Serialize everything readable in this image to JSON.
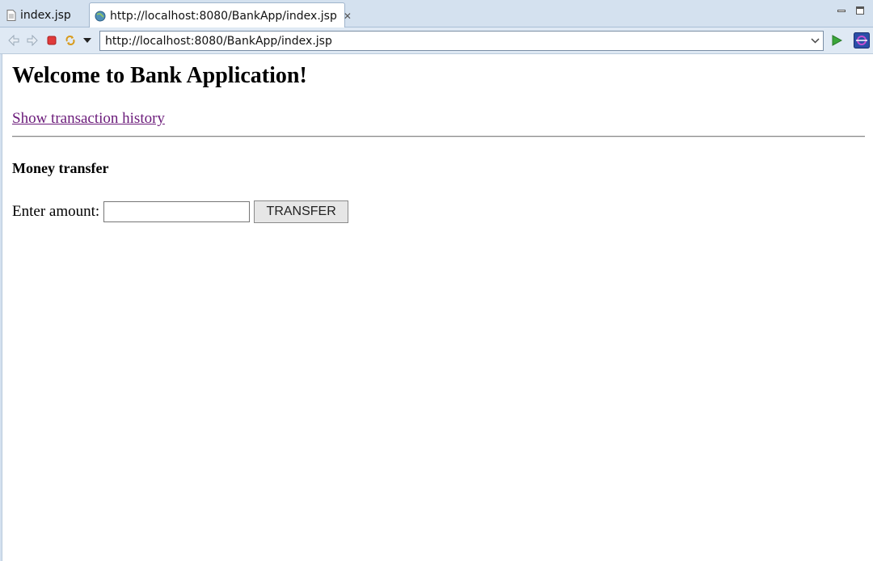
{
  "tabs": [
    {
      "label": "index.jsp",
      "icon": "jsp-file-icon",
      "active": false
    },
    {
      "label": "http://localhost:8080/BankApp/index.jsp",
      "icon": "globe-icon",
      "active": true
    }
  ],
  "toolbar": {
    "url": "http://localhost:8080/BankApp/index.jsp",
    "icons": [
      "back-icon",
      "forward-icon",
      "stop-icon",
      "refresh-icon",
      "menu-dropdown-icon",
      "go-icon",
      "external-browser-icon"
    ]
  },
  "page": {
    "heading": "Welcome to Bank Application!",
    "history_link": "Show transaction history",
    "section_title": "Money transfer",
    "amount_label": "Enter amount:",
    "amount_value": "",
    "transfer_button": "TRANSFER"
  },
  "colors": {
    "link_visited": "#6b1b7a",
    "tabbar_bg": "#d4e1ef",
    "toolbar_bg": "#dfe9f4"
  }
}
